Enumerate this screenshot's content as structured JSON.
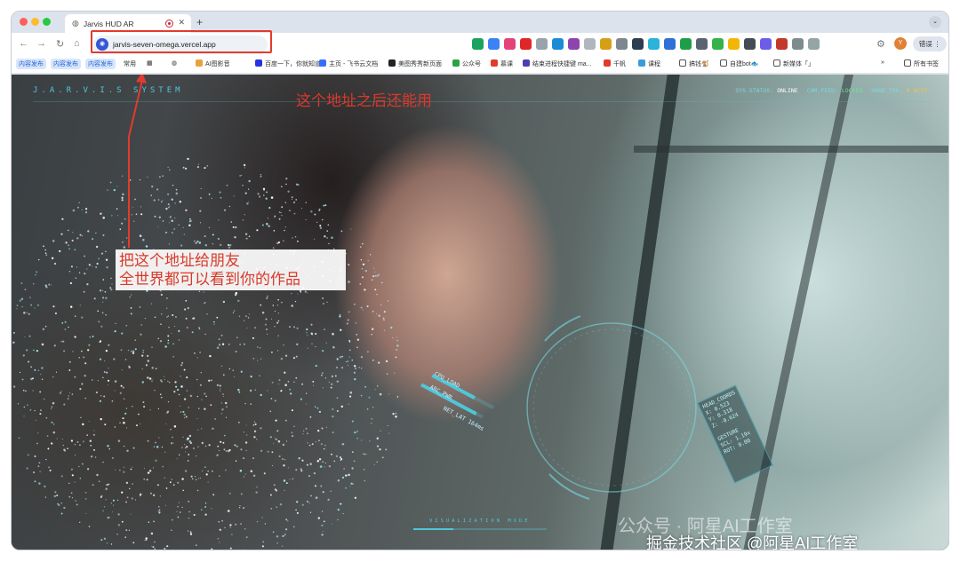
{
  "browser": {
    "tab_title": "Jarvis HUD AR",
    "new_tab_symbol": "+",
    "url": "jarvis-seven-omega.vercel.app",
    "error_button_label": "错误",
    "profile_letter": "Y"
  },
  "bookmarks": {
    "pills": [
      "内容发布",
      "内容发布",
      "内容发布"
    ],
    "frequent": "常用",
    "items": [
      "AI图影音",
      "百度一下，你就知道",
      "主页 - 飞书云文档",
      "美图秀秀新页面",
      "公众号",
      "慕课",
      "结束进程快捷键 ma...",
      "千帆",
      "课程",
      "搞钱🐒",
      "自建bot🐟",
      "新媒体「」"
    ],
    "overflow": "»",
    "all_bookmarks": "所有书签"
  },
  "hud": {
    "title": "J.A.R.V.I.S SYSTEM",
    "status": {
      "sys_label": "SYS.STATUS:",
      "sys_value": "ONLINE",
      "cam_label": "CAM.FEED:",
      "cam_value": "LOCKED",
      "hand_label": "HAND.TRK:",
      "hand_value": "0 ACTV"
    },
    "gauges": [
      "CPU_LOAD",
      "ARC_PWR",
      "NET_LAT 164ms"
    ],
    "head_coords": {
      "title": "HEAD_COORDS",
      "x": "X: 0.523",
      "y": "Y: 0.318",
      "z": "Z: -0.624",
      "gesture_title": "GESTURE",
      "scl": "SCL: 1.19x",
      "rot": "ROT: 0.00"
    },
    "viz_mode": "VISUALIZATION MODE",
    "viz_progress": 0.3
  },
  "annotations": {
    "top": "这个地址之后还能用",
    "middle_line1": "把这个地址给朋友",
    "middle_line2": "全世界都可以看到你的作品",
    "color": "#d93a2a"
  },
  "watermarks": {
    "wechat": "公众号 · 阿星AI工作室",
    "juejin": "掘金技术社区 @阿星AI工作室"
  }
}
